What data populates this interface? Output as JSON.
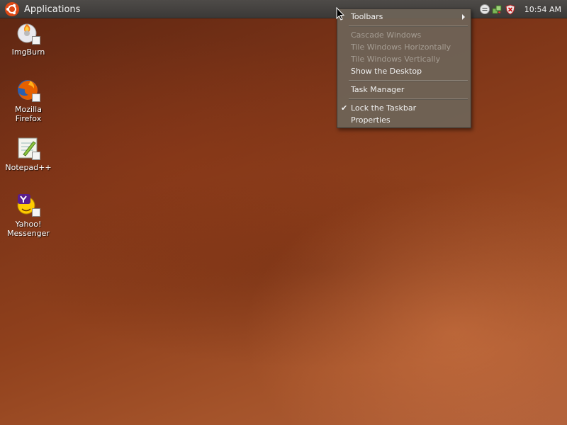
{
  "panel": {
    "apps_label": "Applications",
    "clock": "10:54 AM",
    "tray_icons": [
      "chat-status-icon",
      "network-update-icon",
      "security-shield-icon"
    ]
  },
  "desktop": {
    "icons": [
      {
        "label": "ImgBurn",
        "icon": "imgburn-icon"
      },
      {
        "label": "Mozilla\nFirefox",
        "icon": "firefox-icon"
      },
      {
        "label": "Notepad++",
        "icon": "notepad-plus-plus-icon"
      },
      {
        "label": "Yahoo!\nMessenger",
        "icon": "yahoo-messenger-icon"
      }
    ]
  },
  "context_menu": {
    "items": [
      {
        "label": "Toolbars",
        "enabled": true,
        "submenu": true
      },
      {
        "label": "Cascade Windows",
        "enabled": false
      },
      {
        "label": "Tile Windows Horizontally",
        "enabled": false
      },
      {
        "label": "Tile Windows Vertically",
        "enabled": false
      },
      {
        "label": "Show the Desktop",
        "enabled": true
      },
      {
        "label": "Task Manager",
        "enabled": true
      },
      {
        "label": "Lock the Taskbar",
        "enabled": true,
        "checked": true
      },
      {
        "label": "Properties",
        "enabled": true
      }
    ]
  },
  "colors": {
    "panel": "#3b3937",
    "menu_bg": "#6e6458",
    "desktop_base": "#8f401c",
    "menu_disabled_text": "#a59d93"
  }
}
